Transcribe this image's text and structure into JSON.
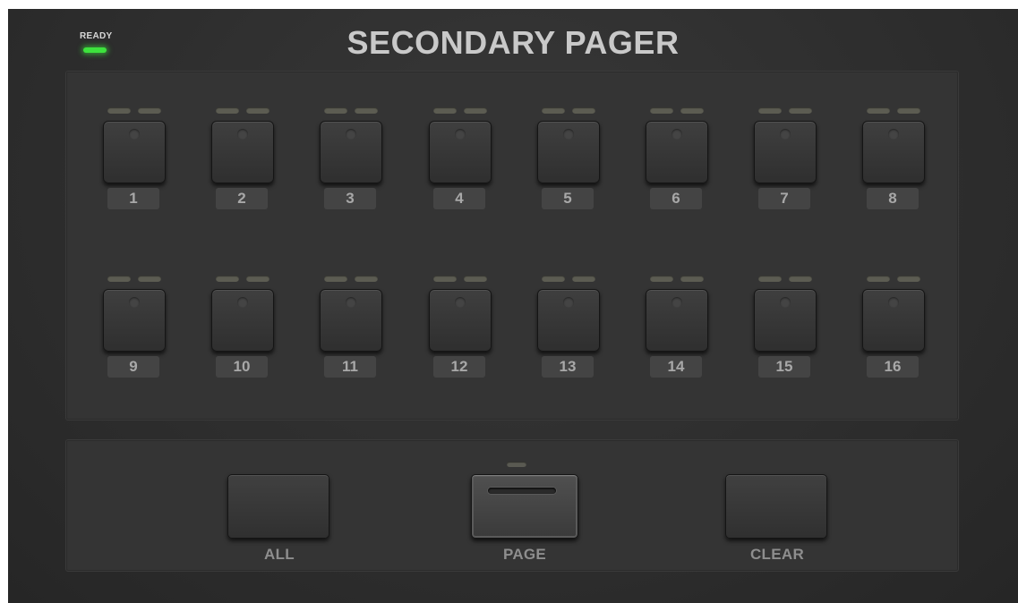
{
  "status": {
    "label": "READY",
    "led_color": "#3de23d"
  },
  "title": "SECONDARY PAGER",
  "channels": [
    {
      "label": "1"
    },
    {
      "label": "2"
    },
    {
      "label": "3"
    },
    {
      "label": "4"
    },
    {
      "label": "5"
    },
    {
      "label": "6"
    },
    {
      "label": "7"
    },
    {
      "label": "8"
    },
    {
      "label": "9"
    },
    {
      "label": "10"
    },
    {
      "label": "11"
    },
    {
      "label": "12"
    },
    {
      "label": "13"
    },
    {
      "label": "14"
    },
    {
      "label": "15"
    },
    {
      "label": "16"
    }
  ],
  "controls": {
    "all": {
      "label": "ALL"
    },
    "page": {
      "label": "PAGE"
    },
    "clear": {
      "label": "CLEAR"
    }
  },
  "colors": {
    "panel": "#2e2e2e",
    "led_off": "#5c5c52",
    "label_text": "#a8a8a8"
  }
}
